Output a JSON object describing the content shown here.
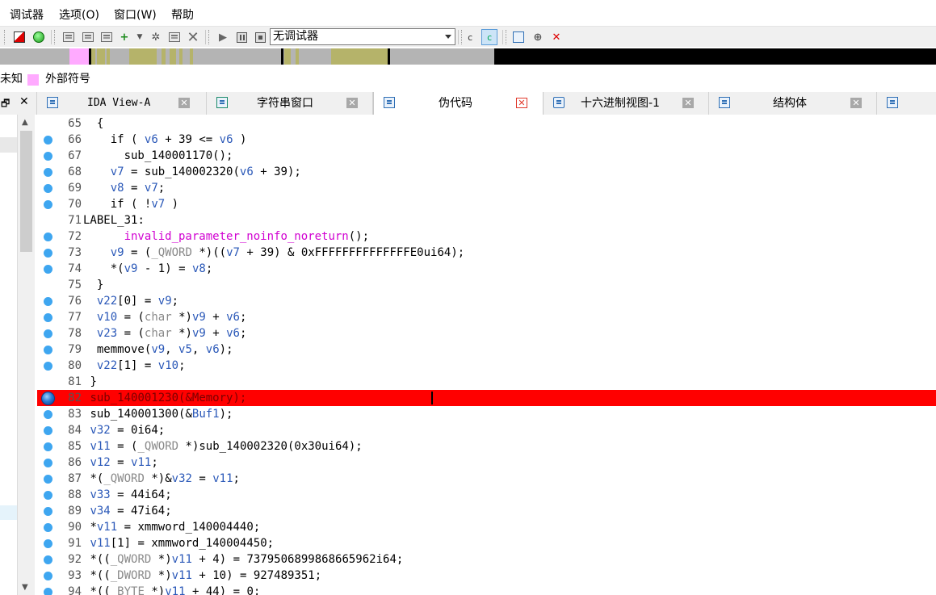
{
  "menu": [
    "调试器",
    "选项(O)",
    "窗口(W)",
    "帮助"
  ],
  "toolbar": {
    "debugger_select_value": "无调试器",
    "icons": [
      "color-icon",
      "green-circle-icon",
      "list-add-icon",
      "list-edit-icon",
      "struct-add-icon",
      "add-step-icon",
      "dropdown-arrow-icon",
      "gear-icon",
      "edit-icon",
      "close-x-icon",
      "play-icon",
      "pause-icon",
      "stop-icon",
      "source-c-icon",
      "cursor-c-icon",
      "attach-icon",
      "breakpoint-add-icon",
      "breakpoint-remove-icon"
    ]
  },
  "legend": {
    "unknown_label": "未知",
    "external_label": "外部符号",
    "external_color": "#ffaaff"
  },
  "colors": {
    "highlight": "#ff0000",
    "variable": "#2a58b8",
    "macro": "#d100d1",
    "punct_type": "#8a8a8a",
    "nav_grey": "#b4b4b4",
    "nav_olive": "#b5b36a",
    "nav_black": "#000000"
  },
  "tabs": [
    {
      "label": "IDA View-A",
      "icon": "disasm-icon",
      "active": false
    },
    {
      "label": "字符串窗口",
      "icon": "strings-icon",
      "active": false
    },
    {
      "label": "伪代码",
      "icon": "pseudocode-icon",
      "active": true
    },
    {
      "label": "十六进制视图-1",
      "icon": "hex-icon",
      "active": false
    },
    {
      "label": "结构体",
      "icon": "struct-icon",
      "active": false
    }
  ],
  "left_panel": {
    "restore_glyph": "🗗",
    "close_glyph": "✕"
  },
  "code_lines": [
    {
      "num": "65",
      "text": "  {"
    },
    {
      "num": "66",
      "text": "    if ( v6 + 39 <= v6 )"
    },
    {
      "num": "67",
      "text": "      sub_140001170();"
    },
    {
      "num": "68",
      "text": "    v7 = sub_140002320(v6 + 39);"
    },
    {
      "num": "69",
      "text": "    v8 = v7;"
    },
    {
      "num": "70",
      "text": "    if ( !v7 )"
    },
    {
      "num": "71",
      "text": "LABEL_31:"
    },
    {
      "num": "72",
      "text": "      invalid_parameter_noinfo_noreturn();"
    },
    {
      "num": "73",
      "text": "    v9 = (_QWORD *)((v7 + 39) & 0xFFFFFFFFFFFFFFE0ui64);"
    },
    {
      "num": "74",
      "text": "    *(v9 - 1) = v8;"
    },
    {
      "num": "75",
      "text": "  }"
    },
    {
      "num": "76",
      "text": "  v22[0] = v9;"
    },
    {
      "num": "77",
      "text": "  v10 = (char *)v9 + v6;"
    },
    {
      "num": "78",
      "text": "  v23 = (char *)v9 + v6;"
    },
    {
      "num": "79",
      "text": "  memmove(v9, v5, v6);"
    },
    {
      "num": "80",
      "text": "  v22[1] = v10;"
    },
    {
      "num": "81",
      "text": " }"
    },
    {
      "num": "82",
      "text": " sub_140001230(&Memory);"
    },
    {
      "num": "83",
      "text": " sub_140001300(&Buf1);"
    },
    {
      "num": "84",
      "text": " v32 = 0i64;"
    },
    {
      "num": "85",
      "text": " v11 = (_QWORD *)sub_140002320(0x30ui64);"
    },
    {
      "num": "86",
      "text": " v12 = v11;"
    },
    {
      "num": "87",
      "text": " *(_QWORD *)&v32 = v11;"
    },
    {
      "num": "88",
      "text": " v33 = 44i64;"
    },
    {
      "num": "89",
      "text": " v34 = 47i64;"
    },
    {
      "num": "90",
      "text": " *v11 = xmmword_140004440;"
    },
    {
      "num": "91",
      "text": " v11[1] = xmmword_140004450;"
    },
    {
      "num": "92",
      "text": " *((_QWORD *)v11 + 4) = 7379506899868665962i64;"
    },
    {
      "num": "93",
      "text": " *((_DWORD *)v11 + 10) = 927489351;"
    },
    {
      "num": "94",
      "text": " *((_BYTE *)v11 + 44) = 0;"
    }
  ]
}
